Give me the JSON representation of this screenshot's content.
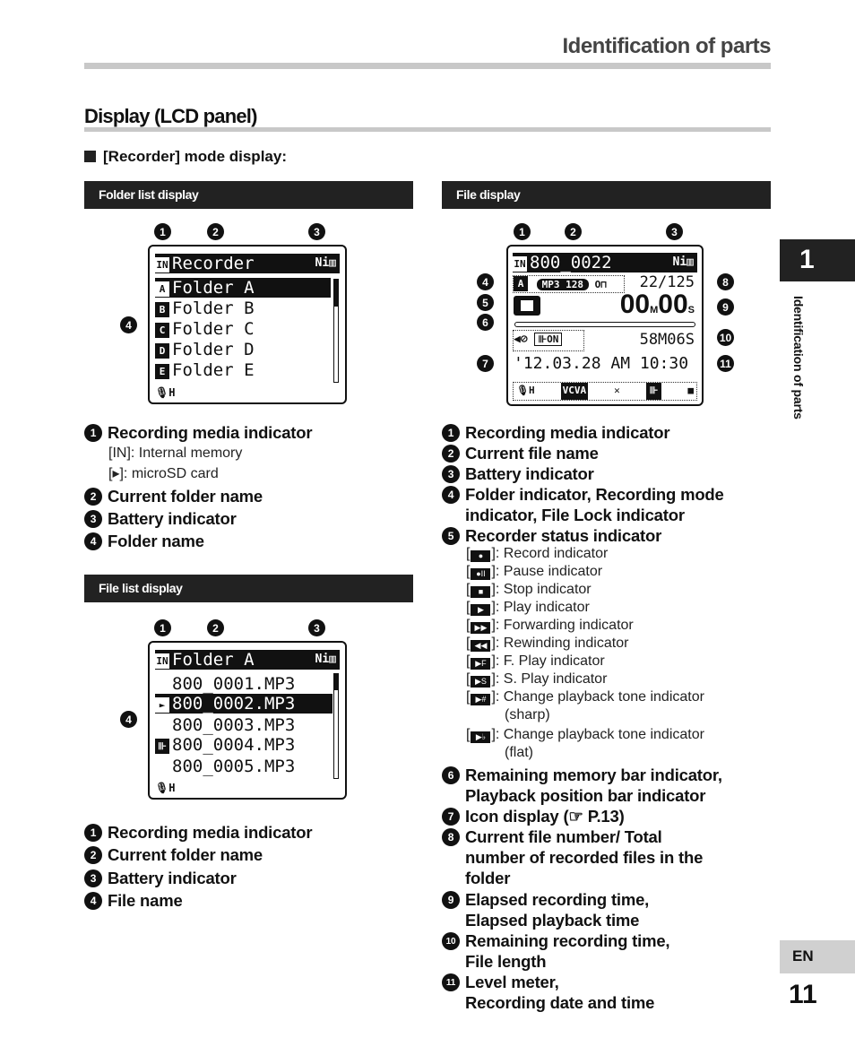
{
  "header": {
    "title": "Identification of parts"
  },
  "section": {
    "title": "Display (LCD panel)",
    "subtitle": "[Recorder] mode display:"
  },
  "side": {
    "chapter": "1",
    "label": "Identification of parts",
    "lang": "EN",
    "page": "11"
  },
  "folder_list": {
    "bar": "Folder list display",
    "lcd": {
      "header": "Recorder",
      "media": "IN",
      "battery": "Ni",
      "rows": [
        {
          "badge": "A",
          "name": "Folder A",
          "selected": true
        },
        {
          "badge": "B",
          "name": "Folder B"
        },
        {
          "badge": "C",
          "name": "Folder C"
        },
        {
          "badge": "D",
          "name": "Folder D"
        },
        {
          "badge": "E",
          "name": "Folder E"
        }
      ],
      "footer": "🎙H"
    },
    "items": [
      {
        "n": "1",
        "label": "Recording media indicator",
        "subs": [
          "[IN]: Internal memory",
          "[▸]: microSD card"
        ]
      },
      {
        "n": "2",
        "label": "Current folder name"
      },
      {
        "n": "3",
        "label": "Battery indicator"
      },
      {
        "n": "4",
        "label": "Folder name"
      }
    ]
  },
  "file_list": {
    "bar": "File list display",
    "lcd": {
      "header": "Folder A",
      "media": "IN",
      "battery": "Ni",
      "rows": [
        {
          "icon": "",
          "name": "800_0001.MP3"
        },
        {
          "icon": "►",
          "name": "800_0002.MP3",
          "selected": true
        },
        {
          "icon": "",
          "name": "800_0003.MP3"
        },
        {
          "icon": "⊪",
          "name": "800_0004.MP3"
        },
        {
          "icon": "",
          "name": "800_0005.MP3"
        }
      ],
      "footer": "🎙H"
    },
    "items": [
      {
        "n": "1",
        "label": "Recording media indicator"
      },
      {
        "n": "2",
        "label": "Current folder name"
      },
      {
        "n": "3",
        "label": "Battery indicator"
      },
      {
        "n": "4",
        "label": "File name"
      }
    ]
  },
  "file_display": {
    "bar": "File display",
    "lcd": {
      "media": "IN",
      "file": "800_0022",
      "battery": "Ni",
      "folder": "A",
      "mode": "MP3 128",
      "lock": "O⊓",
      "count": "22/125",
      "status": "■",
      "elapsed_m": "00",
      "unit_m": "M",
      "elapsed_s": "00",
      "unit_s": "S",
      "icons": "◀⊘",
      "icon2": "⊪ON",
      "remaining": "58M06S",
      "datetime": "'12.03.28 AM 10:30",
      "footer": [
        "🎙H",
        "VCVA",
        "✕",
        "⊪",
        "■"
      ]
    },
    "items": [
      {
        "n": "1",
        "lines": [
          "Recording media indicator"
        ]
      },
      {
        "n": "2",
        "lines": [
          "Current file name"
        ]
      },
      {
        "n": "3",
        "lines": [
          "Battery indicator"
        ]
      },
      {
        "n": "4",
        "lines": [
          "Folder indicator, Recording mode",
          "indicator, File Lock indicator"
        ]
      },
      {
        "n": "5",
        "lines": [
          "Recorder status indicator"
        ]
      },
      {
        "n": "6",
        "lines": [
          "Remaining memory bar indicator,",
          "Playback position bar indicator"
        ]
      },
      {
        "n": "7",
        "lines": [
          "Icon display (☞ P.13)"
        ]
      },
      {
        "n": "8",
        "lines": [
          "Current file number/ Total",
          "number of recorded files in the",
          "folder"
        ]
      },
      {
        "n": "9",
        "lines": [
          "Elapsed recording time,",
          "Elapsed playback time"
        ]
      },
      {
        "n": "10",
        "lines": [
          "Remaining recording time,",
          "File length"
        ]
      },
      {
        "n": "11",
        "lines": [
          "Level meter,",
          "Recording date and time"
        ]
      }
    ],
    "status_subs": [
      {
        "icon": "●",
        "text": "]: Record indicator"
      },
      {
        "icon": "●II",
        "text": "]: Pause indicator"
      },
      {
        "icon": "■",
        "text": "]: Stop indicator"
      },
      {
        "icon": "▶",
        "text": "]: Play indicator"
      },
      {
        "icon": "▶▶",
        "text": "]: Forwarding indicator"
      },
      {
        "icon": "◀◀",
        "text": "]: Rewinding indicator"
      },
      {
        "icon": "▶F",
        "text": "]: F. Play indicator"
      },
      {
        "icon": "▶S",
        "text": "]: S. Play indicator"
      },
      {
        "icon": "▶#",
        "text": "]: Change playback tone indicator",
        "cont": "(sharp)"
      },
      {
        "icon": "▶♭",
        "text": "]: Change playback tone indicator",
        "cont": "(flat)"
      }
    ]
  }
}
